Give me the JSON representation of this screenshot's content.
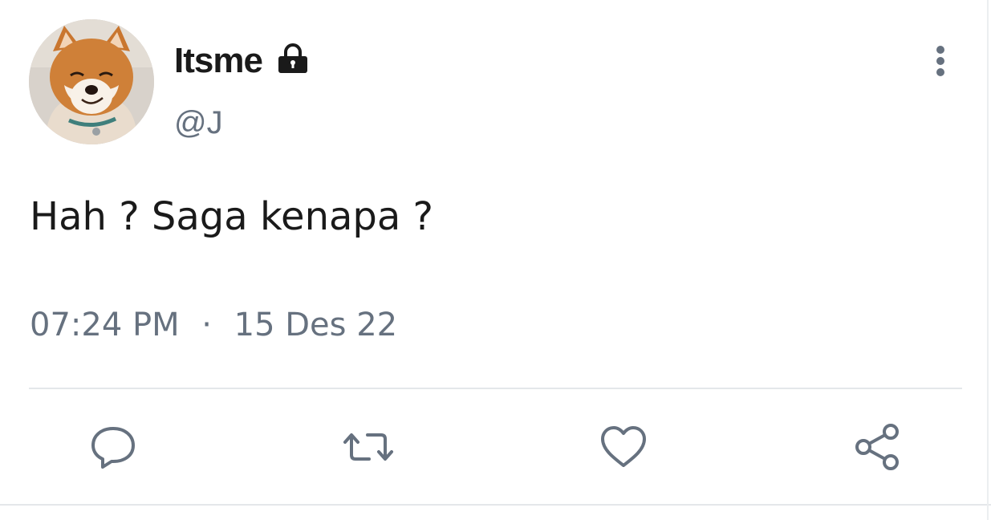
{
  "user": {
    "display_name": "Itsme",
    "handle": "@J",
    "protected_icon": "lock-icon",
    "avatar": "shiba-inu-dog-photo"
  },
  "tweet": {
    "text": "Hah ? Saga kenapa ?",
    "time": "07:24 PM",
    "separator": "·",
    "date": "15 Des 22"
  },
  "actions": [
    {
      "name": "reply",
      "icon": "speech-bubble-icon"
    },
    {
      "name": "retweet",
      "icon": "retweet-icon"
    },
    {
      "name": "like",
      "icon": "heart-icon"
    },
    {
      "name": "share",
      "icon": "share-icon"
    }
  ],
  "more_icon": "vertical-ellipsis-icon",
  "colors": {
    "text": "#1a1a1a",
    "secondary": "#66717f",
    "divider": "#e4e7ea",
    "icon": "#66717f"
  }
}
